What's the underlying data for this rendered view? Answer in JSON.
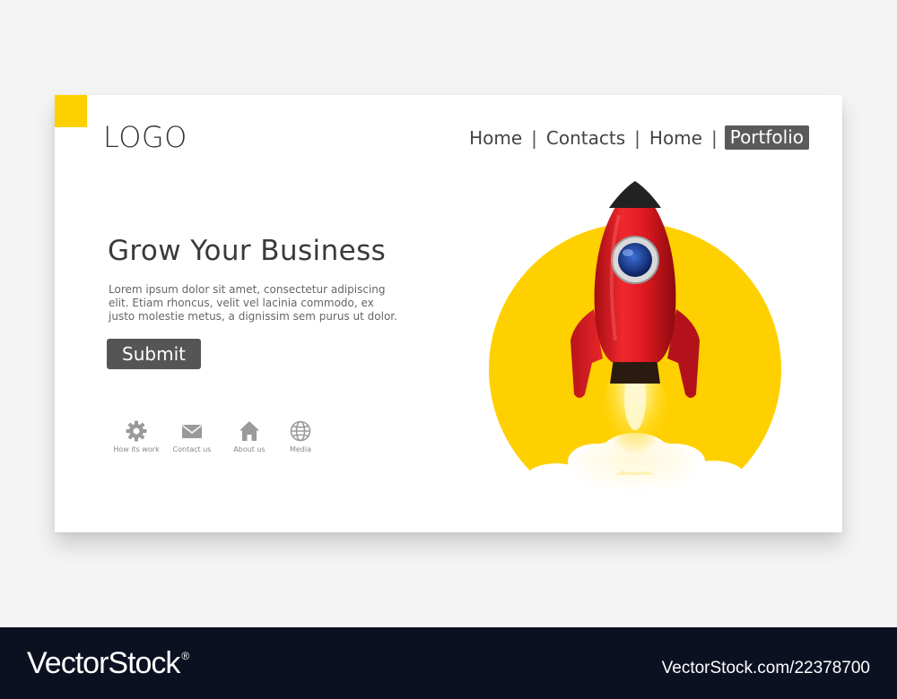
{
  "header": {
    "logo": "LOGO",
    "nav": [
      {
        "label": "Home",
        "active": false
      },
      {
        "label": "Contacts",
        "active": false
      },
      {
        "label": "Home",
        "active": false
      },
      {
        "label": "Portfolio",
        "active": true
      }
    ],
    "separator": "|"
  },
  "hero": {
    "headline": "Grow Your Business",
    "body": "Lorem ipsum dolor sit amet, consectetur adipiscing elit. Etiam rhoncus, velit vel lacinia commodo, ex justo molestie metus, a dignissim sem purus ut dolor.",
    "submit_label": "Submit",
    "illustration": "rocket-launch"
  },
  "features": [
    {
      "label": "How its work",
      "icon": "gear-icon"
    },
    {
      "label": "Contact us",
      "icon": "mail-icon"
    },
    {
      "label": "About us",
      "icon": "home-icon"
    },
    {
      "label": "Media",
      "icon": "globe-icon"
    }
  ],
  "footer": {
    "brand": "VectorStock",
    "registered": "®",
    "url": "VectorStock.com/22378700"
  },
  "colors": {
    "accent": "#ffd000",
    "button": "#555555",
    "rocket": "#e01a22",
    "footer": "#0c1122"
  }
}
